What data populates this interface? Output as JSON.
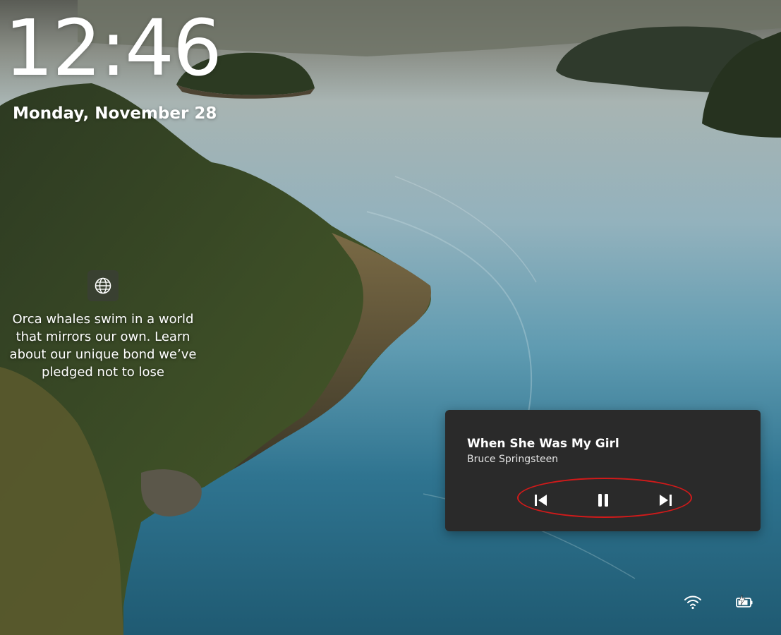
{
  "lockscreen": {
    "time": "12:46",
    "date": "Monday, November 28",
    "spotlight_text": "Orca whales swim in a world that mirrors our own. Learn about our unique bond we’ve pledged not to lose",
    "spotlight_icon": "globe-icon"
  },
  "media": {
    "title": "When She Was My Girl",
    "artist": "Bruce Springsteen",
    "controls": {
      "prev_icon": "previous-track-icon",
      "pause_icon": "pause-icon",
      "next_icon": "next-track-icon"
    },
    "highlight_color": "#d11a1a"
  },
  "tray": {
    "wifi_icon": "wifi-icon",
    "battery_icon": "battery-charging-icon"
  }
}
